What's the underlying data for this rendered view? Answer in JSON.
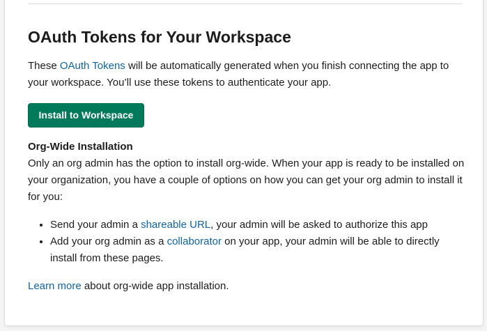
{
  "section": {
    "title": "OAuth Tokens for Your Workspace",
    "intro": {
      "before": "These ",
      "link": "OAuth Tokens",
      "after": " will be automatically generated when you finish connecting the app to your workspace. You’ll use these tokens to authenticate your app."
    },
    "install_button_label": "Install to Workspace"
  },
  "org_wide": {
    "heading": "Org-Wide Installation",
    "description": "Only an org admin has the option to install org-wide. When your app is ready to be installed on your organization, you have a couple of options on how you can get your org admin to install it for you:",
    "options": [
      {
        "before": "Send your admin a ",
        "link": "shareable URL",
        "after": ", your admin will be asked to authorize this app"
      },
      {
        "before": "Add your org admin as a ",
        "link": "collaborator",
        "after": " on your app, your admin will be able to directly install from these pages."
      }
    ],
    "learn_more": {
      "link": "Learn more",
      "after": " about org-wide app installation."
    }
  },
  "colors": {
    "accent": "#007a5a",
    "link": "#1264a3",
    "text": "#1d1c1d"
  }
}
